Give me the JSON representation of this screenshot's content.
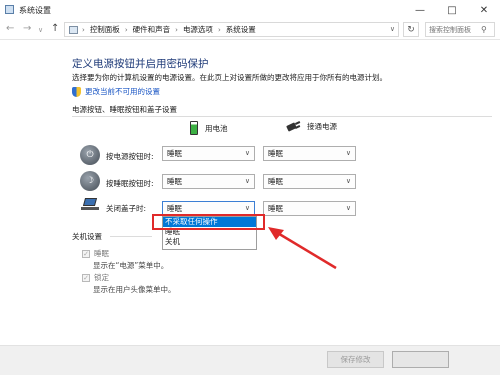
{
  "window": {
    "title": "系统设置"
  },
  "address": {
    "crumbs": [
      "控制面板",
      "硬件和声音",
      "电源选项",
      "系统设置"
    ],
    "search_placeholder": "搜索控制面板"
  },
  "header": {
    "title": "定义电源按钮并启用密码保护",
    "description": "选择要为你的计算机设置的电源设置。在此页上对设置所做的更改将应用于你所有的电源计划。",
    "change_link": "更改当前不可用的设置"
  },
  "buttons_section": {
    "title": "电源按钮、睡眠按钮和盖子设置",
    "columns": {
      "battery": "用电池",
      "plugged": "接通电源"
    },
    "rows": [
      {
        "label": "按电源按钮时:",
        "battery": "睡眠",
        "plugged": "睡眠"
      },
      {
        "label": "按睡眠按钮时:",
        "battery": "睡眠",
        "plugged": "睡眠"
      },
      {
        "label": "关闭盖子时:",
        "battery": "睡眠",
        "plugged": "睡眠"
      }
    ],
    "open_dropdown_options": [
      "不采取任何操作",
      "睡眠",
      "关机"
    ],
    "open_dropdown_selected": "不采取任何操作"
  },
  "shutdown_section": {
    "title": "关机设置",
    "items": [
      {
        "label": "睡眠",
        "description": "显示在“电源”菜单中。",
        "checked": true
      },
      {
        "label": "锁定",
        "description": "显示在用户头像菜单中。",
        "checked": true
      }
    ]
  },
  "footer": {
    "save_label": "保存修改",
    "cancel_label": ""
  },
  "colors": {
    "title": "#1e3a78",
    "link": "#1a56c4",
    "highlight": "#e02a2a",
    "selected": "#0078d7"
  },
  "icons": [
    "app-icon",
    "back-icon",
    "forward-icon",
    "up-icon",
    "refresh-icon",
    "search-icon",
    "shield-icon",
    "battery-icon",
    "plug-icon",
    "power-icon",
    "sleep-icon",
    "lid-icon"
  ]
}
